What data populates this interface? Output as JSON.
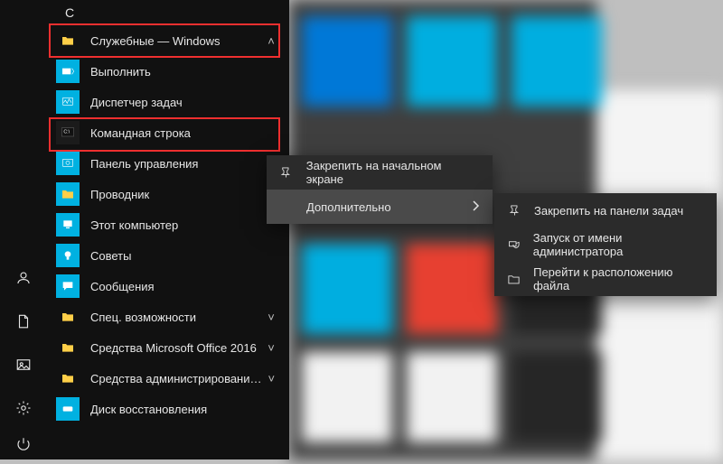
{
  "section_letter": "С",
  "apps": {
    "group": "Служебные — Windows",
    "run": "Выполнить",
    "taskmgr": "Диспетчер задач",
    "cmd": "Командная строка",
    "cpanel": "Панель управления",
    "explorer": "Проводник",
    "thispc": "Этот компьютер",
    "tips": "Советы",
    "messaging": "Сообщения",
    "ease": "Спец. возможности",
    "office": "Средства Microsoft Office 2016",
    "admintools": "Средства администрирования…",
    "recovery": "Диск восстановления"
  },
  "ctx1": {
    "pin_start": "Закрепить на начальном экране",
    "more": "Дополнительно"
  },
  "ctx2": {
    "pin_taskbar": "Закрепить на панели задач",
    "run_admin": "Запуск от имени администратора",
    "open_loc": "Перейти к расположению файла"
  }
}
